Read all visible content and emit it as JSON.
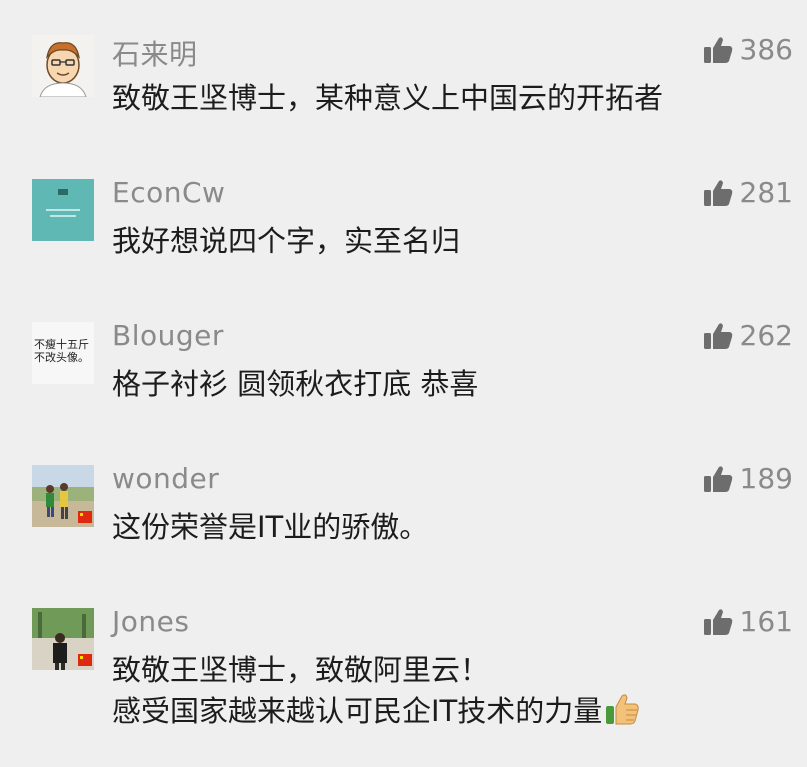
{
  "comments": [
    {
      "username": "石来明",
      "likes": "386",
      "lines": [
        "致敬王坚博士，某种意义上中国云的开拓者"
      ]
    },
    {
      "username": "EconCw",
      "likes": "281",
      "lines": [
        "我好想说四个字，实至名归"
      ]
    },
    {
      "username": "Blouger",
      "likes": "262",
      "avatar_text": [
        "不瘦十五斤",
        "不改头像。"
      ],
      "lines": [
        "格子衬衫 圆领秋衣打底 恭喜"
      ]
    },
    {
      "username": "wonder",
      "likes": "189",
      "lines": [
        "这份荣誉是IT业的骄傲。"
      ]
    },
    {
      "username": "Jones",
      "likes": "161",
      "lines": [
        "致敬王坚博士，致敬阿里云！",
        "感受国家越来越认可民企IT技术的力量"
      ],
      "trailing_emoji": "thumbs-up-emoji"
    }
  ],
  "icons": {
    "like": "thumbs-up-icon"
  },
  "colors": {
    "background": "#efefef",
    "meta_text": "#8a8a8a",
    "body_text": "#1c1c1c",
    "avatar_teal": "#5fb8b3"
  }
}
